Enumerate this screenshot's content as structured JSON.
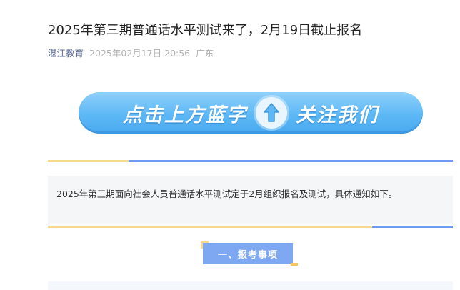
{
  "article": {
    "title": "2025年第三期普通话水平测试来了，2月19日截止报名",
    "source": "湛江教育",
    "date": "2025年02月17日 20:56",
    "region": "广东"
  },
  "banner": {
    "left_text": "点击上方蓝字",
    "right_text": "关注我们",
    "icon": "up-arrow-icon"
  },
  "notice": {
    "text": "2025年第三期面向社会人员普通话水平测试定于2月组织报名及测试，具体通知如下。"
  },
  "section": {
    "heading": "一、报考事项"
  },
  "colors": {
    "accent_blue": "#6f9cf3",
    "accent_yellow": "#f6d98e",
    "link_blue": "#576b95",
    "banner_blue": "#5db8f5"
  }
}
